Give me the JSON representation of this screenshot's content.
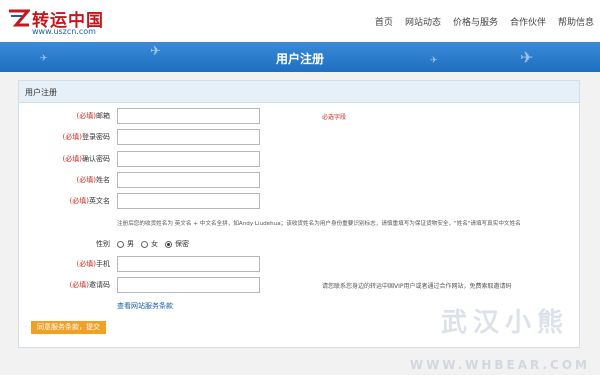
{
  "header": {
    "logo_text": "转运中国",
    "logo_url": "www.uszcn.com",
    "nav": [
      "首页",
      "网站动态",
      "价格与服务",
      "合作伙伴",
      "帮助信息"
    ]
  },
  "banner": {
    "title": "用户注册"
  },
  "panel": {
    "title": "用户注册",
    "required_prefix": "(必填)",
    "fields": {
      "email": {
        "label": "邮箱",
        "value": ""
      },
      "password": {
        "label": "登录密码",
        "value": ""
      },
      "confirm": {
        "label": "确认密码",
        "value": ""
      },
      "name": {
        "label": "姓名",
        "value": ""
      },
      "en_name": {
        "label": "英文名",
        "value": ""
      },
      "phone": {
        "label": "手机",
        "value": ""
      },
      "invite": {
        "label": "邀请码",
        "value": ""
      }
    },
    "required_hint": "必选字段",
    "name_note": "注册后您的收货姓名为 英文名 + 中文名全拼，如Andy Liudehua；该收货姓名为用户身份重要识别标志，请慎重填写为保证货物安全，\"姓名\"请填写真实中文姓名",
    "gender": {
      "label": "性别",
      "options": [
        "男",
        "女",
        "保密"
      ],
      "selected": 2
    },
    "invite_note": "请您联系您身边的转运中国VIP用户或者通过合作网站，免费索取邀请码",
    "terms_link": "查看网站服务条款",
    "submit_label": "同意服务条款，提交"
  },
  "watermark": {
    "text": "武汉小熊",
    "url": "WWW.WHBEAR.COM"
  },
  "colors": {
    "accent": "#1f6fc2",
    "required": "#d9251d",
    "button": "#f0a024",
    "brand": "#c8161d"
  }
}
